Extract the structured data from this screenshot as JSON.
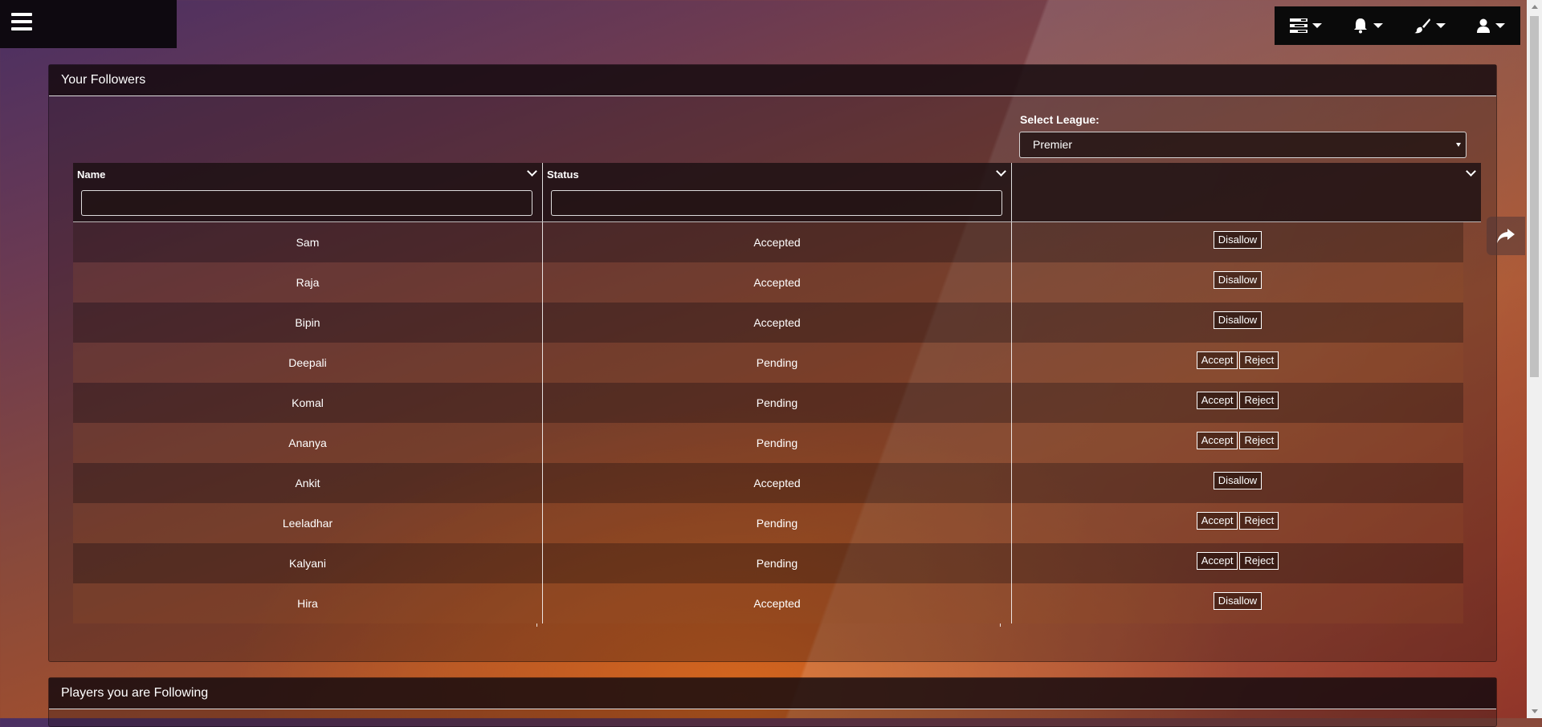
{
  "followers_panel": {
    "title": "Your Followers",
    "select_label": "Select League:",
    "selected_league": "Premier",
    "columns": [
      "Name",
      "Status",
      ""
    ],
    "rows": [
      {
        "name": "Sam",
        "status": "Accepted",
        "actions": [
          "Disallow"
        ]
      },
      {
        "name": "Raja",
        "status": "Accepted",
        "actions": [
          "Disallow"
        ]
      },
      {
        "name": "Bipin",
        "status": "Accepted",
        "actions": [
          "Disallow"
        ]
      },
      {
        "name": "Deepali",
        "status": "Pending",
        "actions": [
          "Accept",
          "Reject"
        ]
      },
      {
        "name": "Komal",
        "status": "Pending",
        "actions": [
          "Accept",
          "Reject"
        ]
      },
      {
        "name": "Ananya",
        "status": "Pending",
        "actions": [
          "Accept",
          "Reject"
        ]
      },
      {
        "name": "Ankit",
        "status": "Accepted",
        "actions": [
          "Disallow"
        ]
      },
      {
        "name": "Leeladhar",
        "status": "Pending",
        "actions": [
          "Accept",
          "Reject"
        ]
      },
      {
        "name": "Kalyani",
        "status": "Pending",
        "actions": [
          "Accept",
          "Reject"
        ]
      },
      {
        "name": "Hira",
        "status": "Accepted",
        "actions": [
          "Disallow"
        ]
      }
    ]
  },
  "following_panel": {
    "title": "Players you are Following"
  },
  "topbar": {
    "icons": [
      "tasks-icon",
      "bell-icon",
      "paint-brush-icon",
      "user-icon"
    ]
  }
}
